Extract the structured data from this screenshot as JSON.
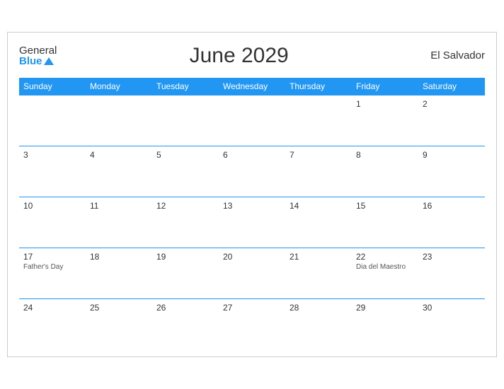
{
  "logo": {
    "general": "General",
    "blue": "Blue"
  },
  "header": {
    "title": "June 2029",
    "country": "El Salvador"
  },
  "weekdays": [
    "Sunday",
    "Monday",
    "Tuesday",
    "Wednesday",
    "Thursday",
    "Friday",
    "Saturday"
  ],
  "rows": [
    [
      {
        "day": "",
        "holiday": ""
      },
      {
        "day": "",
        "holiday": ""
      },
      {
        "day": "",
        "holiday": ""
      },
      {
        "day": "",
        "holiday": ""
      },
      {
        "day": "",
        "holiday": ""
      },
      {
        "day": "1",
        "holiday": ""
      },
      {
        "day": "2",
        "holiday": ""
      }
    ],
    [
      {
        "day": "3",
        "holiday": ""
      },
      {
        "day": "4",
        "holiday": ""
      },
      {
        "day": "5",
        "holiday": ""
      },
      {
        "day": "6",
        "holiday": ""
      },
      {
        "day": "7",
        "holiday": ""
      },
      {
        "day": "8",
        "holiday": ""
      },
      {
        "day": "9",
        "holiday": ""
      }
    ],
    [
      {
        "day": "10",
        "holiday": ""
      },
      {
        "day": "11",
        "holiday": ""
      },
      {
        "day": "12",
        "holiday": ""
      },
      {
        "day": "13",
        "holiday": ""
      },
      {
        "day": "14",
        "holiday": ""
      },
      {
        "day": "15",
        "holiday": ""
      },
      {
        "day": "16",
        "holiday": ""
      }
    ],
    [
      {
        "day": "17",
        "holiday": "Father's Day"
      },
      {
        "day": "18",
        "holiday": ""
      },
      {
        "day": "19",
        "holiday": ""
      },
      {
        "day": "20",
        "holiday": ""
      },
      {
        "day": "21",
        "holiday": ""
      },
      {
        "day": "22",
        "holiday": "Dia del Maestro"
      },
      {
        "day": "23",
        "holiday": ""
      }
    ],
    [
      {
        "day": "24",
        "holiday": ""
      },
      {
        "day": "25",
        "holiday": ""
      },
      {
        "day": "26",
        "holiday": ""
      },
      {
        "day": "27",
        "holiday": ""
      },
      {
        "day": "28",
        "holiday": ""
      },
      {
        "day": "29",
        "holiday": ""
      },
      {
        "day": "30",
        "holiday": ""
      }
    ]
  ]
}
